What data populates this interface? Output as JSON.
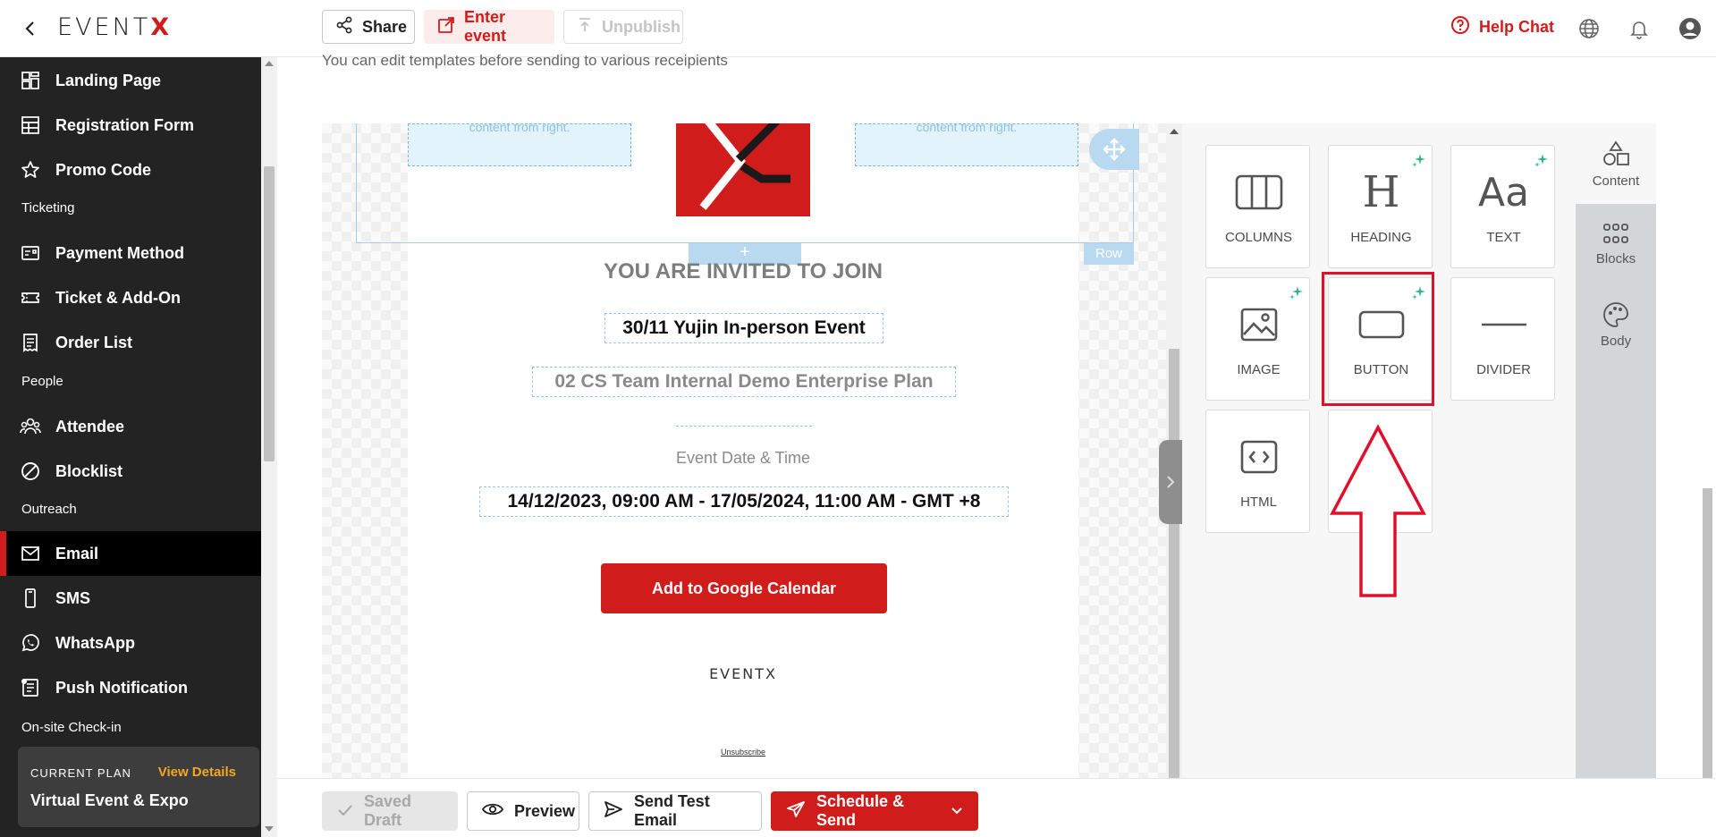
{
  "header": {
    "logo_text": "EVENT",
    "logo_x": "X",
    "share_label": "Share",
    "enter_event_label": "Enter event",
    "unpublish_label": "Unpublish",
    "help_chat_label": "Help Chat"
  },
  "sidebar": {
    "items": {
      "landing_page": "Landing Page",
      "registration_form": "Registration Form",
      "promo_code": "Promo Code",
      "payment_method": "Payment Method",
      "ticket_addon": "Ticket & Add-On",
      "order_list": "Order List",
      "attendee": "Attendee",
      "blocklist": "Blocklist",
      "email": "Email",
      "sms": "SMS",
      "whatsapp": "WhatsApp",
      "push_notification": "Push Notification"
    },
    "sections": {
      "ticketing": "Ticketing",
      "people": "People",
      "outreach": "Outreach",
      "onsite": "On-site Check-in"
    },
    "active_item": "Email",
    "plan": {
      "label": "CURRENT PLAN",
      "link": "View Details",
      "name": "Virtual Event & Expo"
    }
  },
  "main": {
    "subtitle": "You can edit templates before sending to various receipients"
  },
  "email_preview": {
    "placeholder_text": "content from right.",
    "row_label": "Row",
    "add_symbol": "+",
    "invited_heading": "YOU ARE INVITED TO JOIN",
    "event_title": "30/11 Yujin In-person Event",
    "event_subtitle": "02 CS Team Internal Demo Enterprise Plan",
    "date_label": "Event Date & Time",
    "event_datetime": "14/12/2023, 09:00 AM - 17/05/2024, 11:00 AM - GMT +8",
    "calendar_button": "Add to Google Calendar",
    "footer_logo": "EVENTX",
    "unsubscribe": "Unsubscribe"
  },
  "content_panel": {
    "tiles": {
      "columns": "COLUMNS",
      "heading": "HEADING",
      "text": "TEXT",
      "image": "IMAGE",
      "button": "BUTTON",
      "divider": "DIVIDER",
      "html": "HTML"
    },
    "heading_glyph": "H",
    "text_glyph": "Aa",
    "rail": {
      "content": "Content",
      "blocks": "Blocks",
      "body": "Body"
    },
    "highlighted_tile": "BUTTON"
  },
  "footer": {
    "saved_draft": "Saved Draft",
    "preview": "Preview",
    "send_test": "Send Test Email",
    "schedule_send": "Schedule & Send"
  },
  "colors": {
    "brand_red": "#d11c1c",
    "sidebar_bg": "#232323",
    "plan_link": "#f5a623",
    "sparkle": "#2bb58a",
    "highlight": "#e0102a"
  }
}
